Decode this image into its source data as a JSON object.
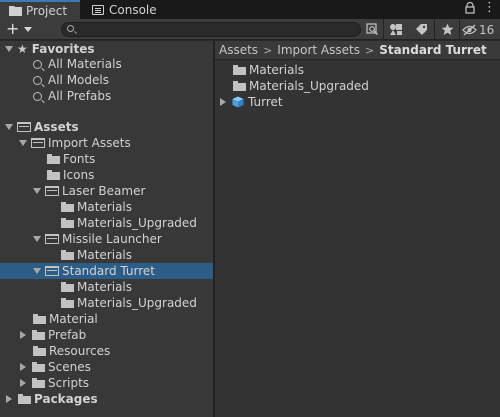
{
  "tabs": {
    "project": "Project",
    "console": "Console"
  },
  "toolbar": {
    "plus": "+",
    "visibility_count": "16"
  },
  "search": {
    "placeholder": ""
  },
  "tree": {
    "favorites": {
      "label": "Favorites",
      "items": [
        "All Materials",
        "All Models",
        "All Prefabs"
      ]
    },
    "assets": {
      "label": "Assets",
      "import_assets": "Import Assets",
      "fonts": "Fonts",
      "icons": "Icons",
      "laser_beamer": "Laser Beamer",
      "laser_materials": "Materials",
      "laser_materials_upgraded": "Materials_Upgraded",
      "missile_launcher": "Missile Launcher",
      "missile_materials": "Materials",
      "standard_turret": "Standard Turret",
      "turret_materials": "Materials",
      "turret_materials_upgraded": "Materials_Upgraded",
      "material": "Material",
      "prefab": "Prefab",
      "resources": "Resources",
      "scenes": "Scenes",
      "scripts": "Scripts"
    },
    "packages": {
      "label": "Packages"
    }
  },
  "breadcrumb": [
    "Assets",
    "Import Assets",
    "Standard Turret"
  ],
  "content": {
    "items": [
      "Materials",
      "Materials_Upgraded",
      "Turret"
    ]
  },
  "colors": {
    "selection": "#2c5d87",
    "tab_accent": "#3a79bb",
    "cube_icon": "#5aa9e6"
  }
}
